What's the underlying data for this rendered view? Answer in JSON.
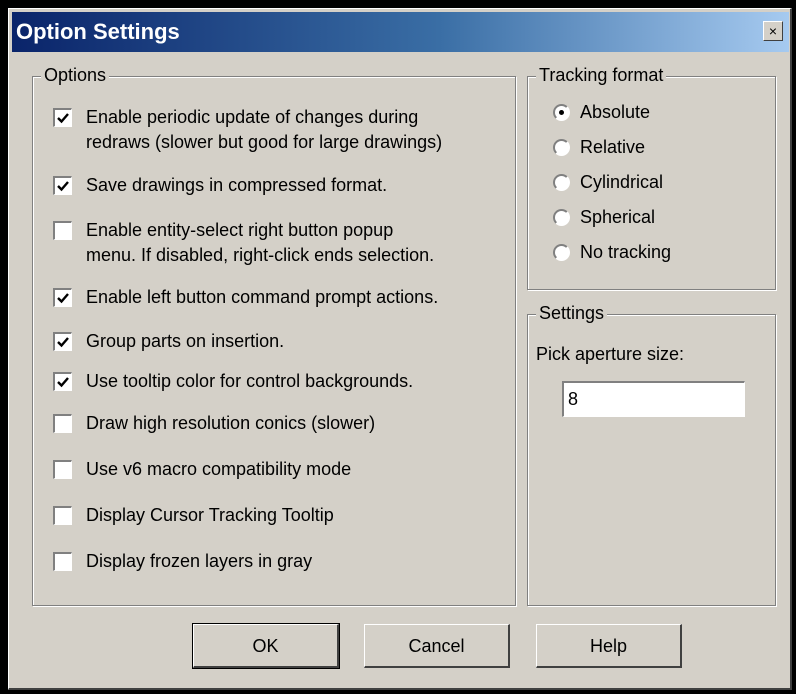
{
  "window": {
    "title": "Option Settings",
    "close_glyph": "×"
  },
  "options": {
    "legend": "Options",
    "items": [
      {
        "label": "Enable periodic update of changes during\nredraws (slower but good for large drawings)",
        "checked": true
      },
      {
        "label": "Save drawings in compressed format.",
        "checked": true
      },
      {
        "label": "Enable entity-select right button popup\nmenu. If disabled, right-click ends selection.",
        "checked": false
      },
      {
        "label": "Enable left button command prompt actions.",
        "checked": true
      },
      {
        "label": "Group parts on insertion.",
        "checked": true
      },
      {
        "label": "Use tooltip color for control backgrounds.",
        "checked": true
      },
      {
        "label": "Draw high resolution conics (slower)",
        "checked": false
      },
      {
        "label": "Use v6 macro compatibility mode",
        "checked": false
      },
      {
        "label": "Display Cursor Tracking Tooltip",
        "checked": false
      },
      {
        "label": "Display frozen layers in gray",
        "checked": false
      }
    ]
  },
  "tracking": {
    "legend": "Tracking format",
    "options": [
      "Absolute",
      "Relative",
      "Cylindrical",
      "Spherical",
      "No tracking"
    ],
    "selected": "Absolute"
  },
  "settings": {
    "legend": "Settings",
    "aperture_label": "Pick aperture size:",
    "aperture_value": "8"
  },
  "buttons": {
    "ok": "OK",
    "cancel": "Cancel",
    "help": "Help"
  },
  "colors": {
    "face": "#d4d0c8",
    "title_start": "#0a246a",
    "title_end": "#a6caf0"
  }
}
